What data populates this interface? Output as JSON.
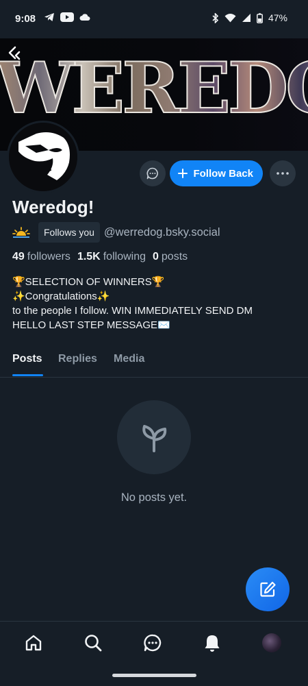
{
  "status_bar": {
    "time": "9:08",
    "battery": "47%"
  },
  "banner": {
    "text": "WEREDO"
  },
  "profile": {
    "display_name": "Weredog!",
    "follows_you_label": "Follows you",
    "handle": "@werredog.bsky.social",
    "follow_button_label": "Follow Back",
    "stats": {
      "followers_count": "49",
      "followers_label": "followers",
      "following_count": "1.5K",
      "following_label": "following",
      "posts_count": "0",
      "posts_label": "posts"
    },
    "bio": [
      "🏆SELECTION OF WINNERS🏆",
      "✨Congratulations✨",
      "to the people I follow. WIN IMMEDIATELY SEND DM",
      "HELLO LAST STEP MESSAGE✉️"
    ]
  },
  "tabs": [
    {
      "label": "Posts",
      "active": true
    },
    {
      "label": "Replies",
      "active": false
    },
    {
      "label": "Media",
      "active": false
    }
  ],
  "empty_state": {
    "text": "No posts yet.",
    "icon": "seedling-icon"
  },
  "bottom_nav": {
    "items": [
      "home-icon",
      "search-icon",
      "chat-icon",
      "bell-icon",
      "avatar"
    ]
  },
  "colors": {
    "background": "#161e27",
    "accent": "#1184f6",
    "muted_text": "#a9b4c0"
  }
}
